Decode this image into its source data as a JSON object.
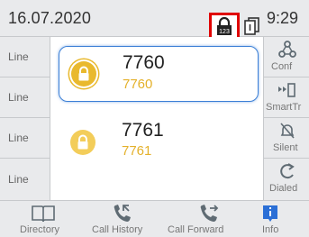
{
  "status_bar": {
    "date": "16.07.2020",
    "time": "9:29",
    "lock_badge_text": "123"
  },
  "line_keys": [
    "Line",
    "Line",
    "Line",
    "Line"
  ],
  "calls": [
    {
      "number": "7760",
      "name": "7760",
      "state": "active"
    },
    {
      "number": "7761",
      "name": "7761",
      "state": "held"
    }
  ],
  "soft_keys": [
    {
      "label": "Conf",
      "icon": "conference-icon"
    },
    {
      "label": "SmartTr",
      "icon": "smart-transfer-icon"
    },
    {
      "label": "Silent",
      "icon": "silent-bell-icon"
    },
    {
      "label": "Dialed",
      "icon": "redial-icon"
    }
  ],
  "bottom_nav": [
    {
      "label": "Directory",
      "icon": "book-icon"
    },
    {
      "label": "Call History",
      "icon": "call-history-icon"
    },
    {
      "label": "Call Forward",
      "icon": "call-forward-icon"
    },
    {
      "label": "Info",
      "icon": "info-icon"
    }
  ],
  "colors": {
    "accent_blue": "#3b7fd6",
    "lock_yellow": "#e9b92e",
    "highlight_red": "#e00000",
    "icon_grey": "#5f6b73",
    "info_blue": "#2b6fd6"
  }
}
